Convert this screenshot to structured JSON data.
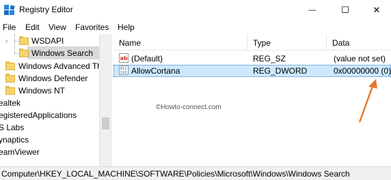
{
  "window": {
    "title": "Registry Editor",
    "minimize_glyph": "—",
    "maximize_glyph": "☐",
    "close_glyph": "✕"
  },
  "menu": [
    "File",
    "Edit",
    "View",
    "Favorites",
    "Help"
  ],
  "tree": {
    "items": [
      {
        "label": "WSDAPI"
      },
      {
        "label": "Windows Search",
        "selected": true
      },
      {
        "label": "Windows Advanced Th"
      },
      {
        "label": "Windows Defender"
      },
      {
        "label": "Windows NT"
      },
      {
        "label": "ealtek"
      },
      {
        "label": "egisteredApplications"
      },
      {
        "label": "S Labs"
      },
      {
        "label": "ynaptics"
      },
      {
        "label": "eamViewer"
      }
    ]
  },
  "columns": {
    "name": "Name",
    "type": "Type",
    "data": "Data"
  },
  "values": [
    {
      "name": "(Default)",
      "type": "REG_SZ",
      "data": "(value not set)",
      "icon": "string-value-icon"
    },
    {
      "name": "AllowCortana",
      "type": "REG_DWORD",
      "data": "0x00000000 (0)",
      "icon": "binary-value-icon",
      "selected": true
    }
  ],
  "watermark": "©Howto-connect.com",
  "statusbar": {
    "path": "Computer\\HKEY_LOCAL_MACHINE\\SOFTWARE\\Policies\\Microsoft\\Windows\\Windows Search"
  },
  "colors": {
    "selection": "#cce8ff",
    "arrow": "#e8772e",
    "folder": "#f6d36b"
  }
}
